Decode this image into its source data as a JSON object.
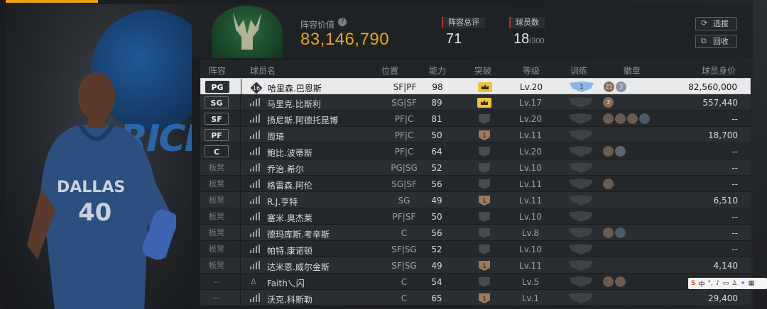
{
  "header": {
    "roster_value_label": "阵容价值",
    "roster_value": "83,146,790",
    "overall_label": "阵容总评",
    "overall_value": "71",
    "count_label": "球员数",
    "count_value": "18",
    "count_max": "/300",
    "select_label": "选拔",
    "recycle_label": "回收"
  },
  "left_panel": {
    "logo_text": "DALLAS MAVERICKS",
    "jersey_team": "DALLAS",
    "jersey_number": "40"
  },
  "table": {
    "columns": [
      "阵容",
      "球员名",
      "位置",
      "能力",
      "突破",
      "等级",
      "训练",
      "徽章",
      "球员身价"
    ],
    "rows": [
      {
        "role": "PG",
        "role_type": "starter",
        "rank_icon": "16",
        "name": "哈里森.巴恩斯",
        "pos": "SF|PF",
        "ovr": "98",
        "breakthrough": "gold",
        "level": "Lv.20",
        "training": "1",
        "badges": [
          {
            "c": "#8a6a52",
            "t": "21"
          },
          {
            "c": "#8a94a6",
            "t": "3"
          }
        ],
        "price": "82,560,000",
        "selected": true
      },
      {
        "role": "SG",
        "role_type": "starter",
        "name": "马里克.比斯利",
        "pos": "SG|SF",
        "ovr": "89",
        "breakthrough": "gold",
        "level": "Lv.17",
        "training": "",
        "badges": [
          {
            "c": "#8a6a52",
            "t": "3"
          }
        ],
        "price": "557,440"
      },
      {
        "role": "SF",
        "role_type": "starter",
        "name": "扬尼斯.阿德托昆博",
        "pos": "PF|C",
        "ovr": "81",
        "breakthrough": "",
        "level": "Lv.20",
        "training": "",
        "badges": [
          {
            "c": "#6b5a4e",
            "t": ""
          },
          {
            "c": "#6b5a4e",
            "t": ""
          },
          {
            "c": "#6b5a4e",
            "t": ""
          },
          {
            "c": "#4d5a6e",
            "t": ""
          }
        ],
        "price": "--"
      },
      {
        "role": "PF",
        "role_type": "starter",
        "name": "周琦",
        "pos": "PF|C",
        "ovr": "50",
        "breakthrough": "1",
        "level": "Lv.11",
        "training": "",
        "badges": [],
        "price": "18,700"
      },
      {
        "role": "C",
        "role_type": "starter",
        "name": "鲍比.波蒂斯",
        "pos": "PF|C",
        "ovr": "64",
        "breakthrough": "",
        "level": "Lv.20",
        "training": "",
        "badges": [
          {
            "c": "#6b5a4e",
            "t": ""
          },
          {
            "c": "#5f6470",
            "t": ""
          }
        ],
        "price": "--"
      },
      {
        "role": "板凳",
        "role_type": "bench",
        "name": "乔治.希尔",
        "pos": "PG|SG",
        "ovr": "52",
        "breakthrough": "",
        "level": "Lv.10",
        "training": "",
        "badges": [],
        "price": "--"
      },
      {
        "role": "板凳",
        "role_type": "bench",
        "name": "格雷森.阿伦",
        "pos": "SG|SF",
        "ovr": "56",
        "breakthrough": "",
        "level": "Lv.11",
        "training": "",
        "badges": [
          {
            "c": "#6b5a4e",
            "t": ""
          }
        ],
        "price": "--"
      },
      {
        "role": "板凳",
        "role_type": "bench",
        "name": "R.J.亨特",
        "pos": "SG",
        "ovr": "49",
        "breakthrough": "1",
        "level": "Lv.11",
        "training": "",
        "badges": [],
        "price": "6,510"
      },
      {
        "role": "板凳",
        "role_type": "bench",
        "name": "塞米.奥杰莱",
        "pos": "PF|SF",
        "ovr": "50",
        "breakthrough": "",
        "level": "Lv.10",
        "training": "",
        "badges": [],
        "price": "--"
      },
      {
        "role": "板凳",
        "role_type": "bench",
        "name": "德玛库斯.考辛斯",
        "pos": "C",
        "ovr": "56",
        "breakthrough": "",
        "level": "Lv.8",
        "training": "",
        "badges": [
          {
            "c": "#6b5a4e",
            "t": ""
          },
          {
            "c": "#4d5a6e",
            "t": ""
          }
        ],
        "price": "--"
      },
      {
        "role": "板凳",
        "role_type": "bench",
        "name": "帕特.康诺顿",
        "pos": "SF|SG",
        "ovr": "52",
        "breakthrough": "",
        "level": "Lv.10",
        "training": "",
        "badges": [],
        "price": "--"
      },
      {
        "role": "板凳",
        "role_type": "bench",
        "name": "达米恩.威尔金斯",
        "pos": "SF|SG",
        "ovr": "49",
        "breakthrough": "1",
        "level": "Lv.11",
        "training": "",
        "badges": [],
        "price": "4,140"
      },
      {
        "role": "--",
        "role_type": "none",
        "name": "Faith乀闪",
        "pos": "C",
        "ovr": "54",
        "breakthrough": "",
        "level": "Lv.5",
        "training": "",
        "badges": [
          {
            "c": "#6b5a4e",
            "t": ""
          },
          {
            "c": "#6b5a4e",
            "t": ""
          }
        ],
        "price": "--",
        "user_icon": true
      },
      {
        "role": "--",
        "role_type": "none",
        "name": "沃克.科斯勒",
        "pos": "C",
        "ovr": "65",
        "breakthrough": "1",
        "level": "Lv.1",
        "training": "",
        "badges": [],
        "price": "29,400"
      }
    ]
  },
  "ime_bar": {
    "text": "中"
  }
}
